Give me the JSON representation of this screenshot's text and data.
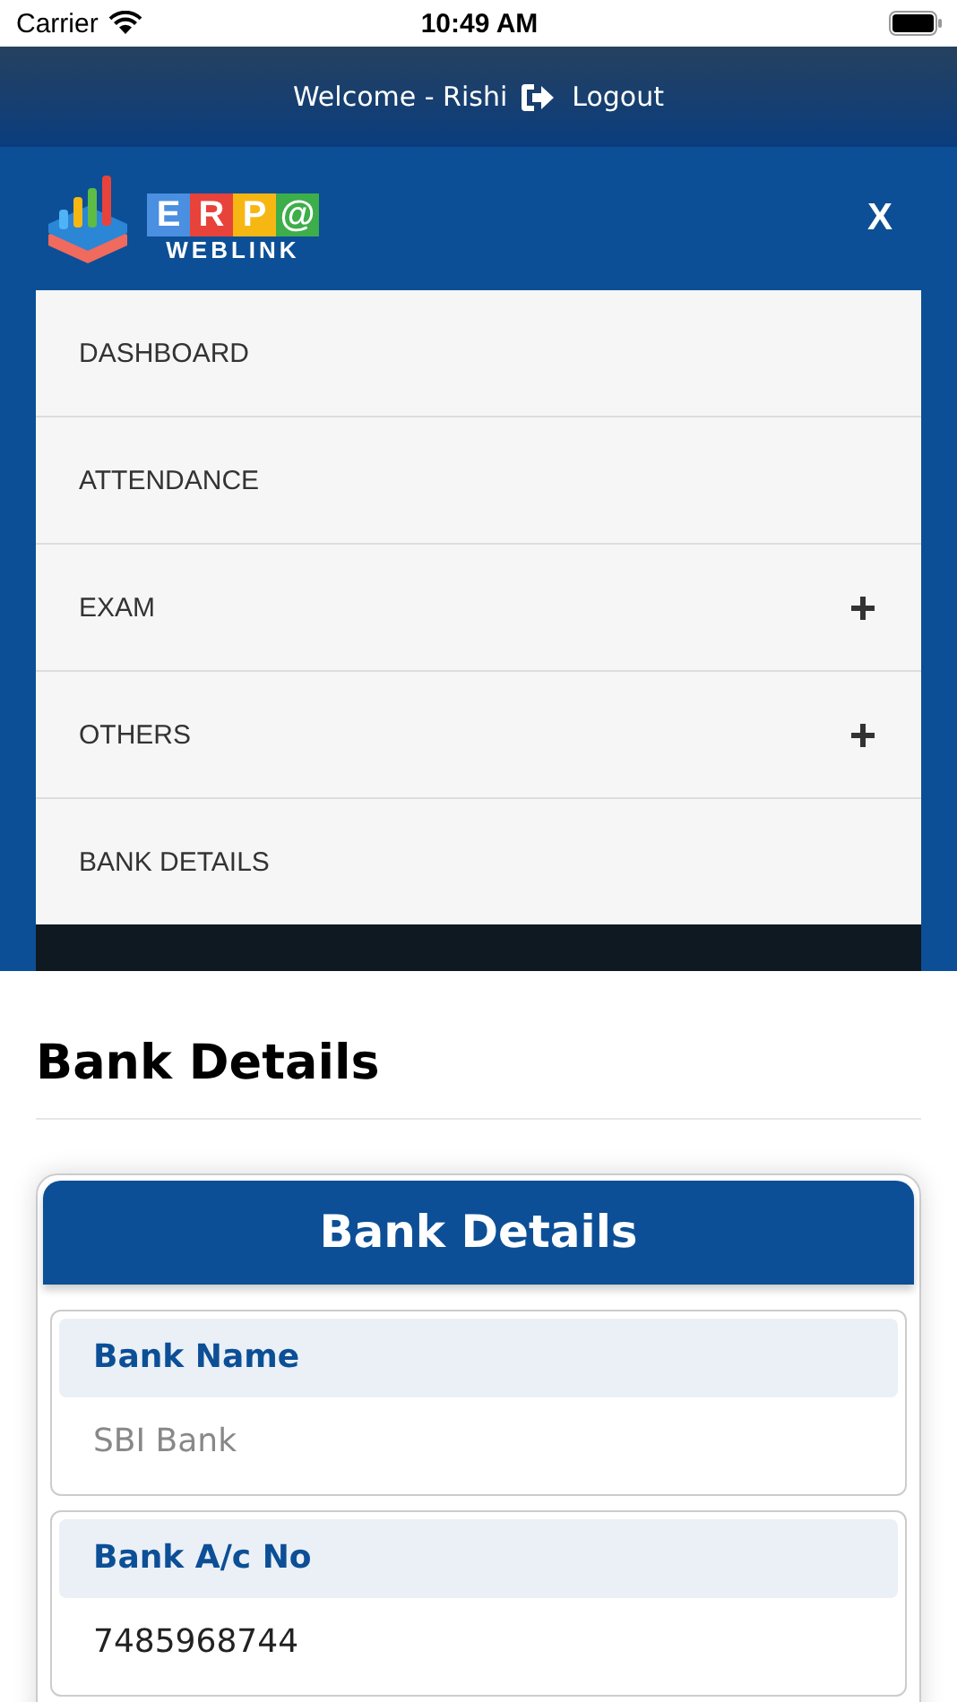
{
  "status_bar": {
    "carrier": "Carrier",
    "time": "10:49 AM"
  },
  "header": {
    "welcome": "Welcome - Rishi",
    "logout": "Logout"
  },
  "logo": {
    "tiles": [
      {
        "letter": "E",
        "color": "#4a8fe0"
      },
      {
        "letter": "R",
        "color": "#e8433a"
      },
      {
        "letter": "P",
        "color": "#f7b713"
      },
      {
        "letter": "@",
        "color": "#3dae4a"
      }
    ],
    "subtitle": "WEBLINK"
  },
  "close_label": "X",
  "menu": [
    {
      "label": "DASHBOARD",
      "expandable": false
    },
    {
      "label": "ATTENDANCE",
      "expandable": false
    },
    {
      "label": "EXAM",
      "expandable": true
    },
    {
      "label": "OTHERS",
      "expandable": true
    },
    {
      "label": "BANK DETAILS",
      "expandable": false
    }
  ],
  "page_title": "Bank Details",
  "card": {
    "title": "Bank Details",
    "fields": [
      {
        "label": "Bank Name",
        "value": "SBI Bank",
        "muted": true
      },
      {
        "label": "Bank A/c No",
        "value": "7485968744",
        "muted": false
      }
    ]
  }
}
